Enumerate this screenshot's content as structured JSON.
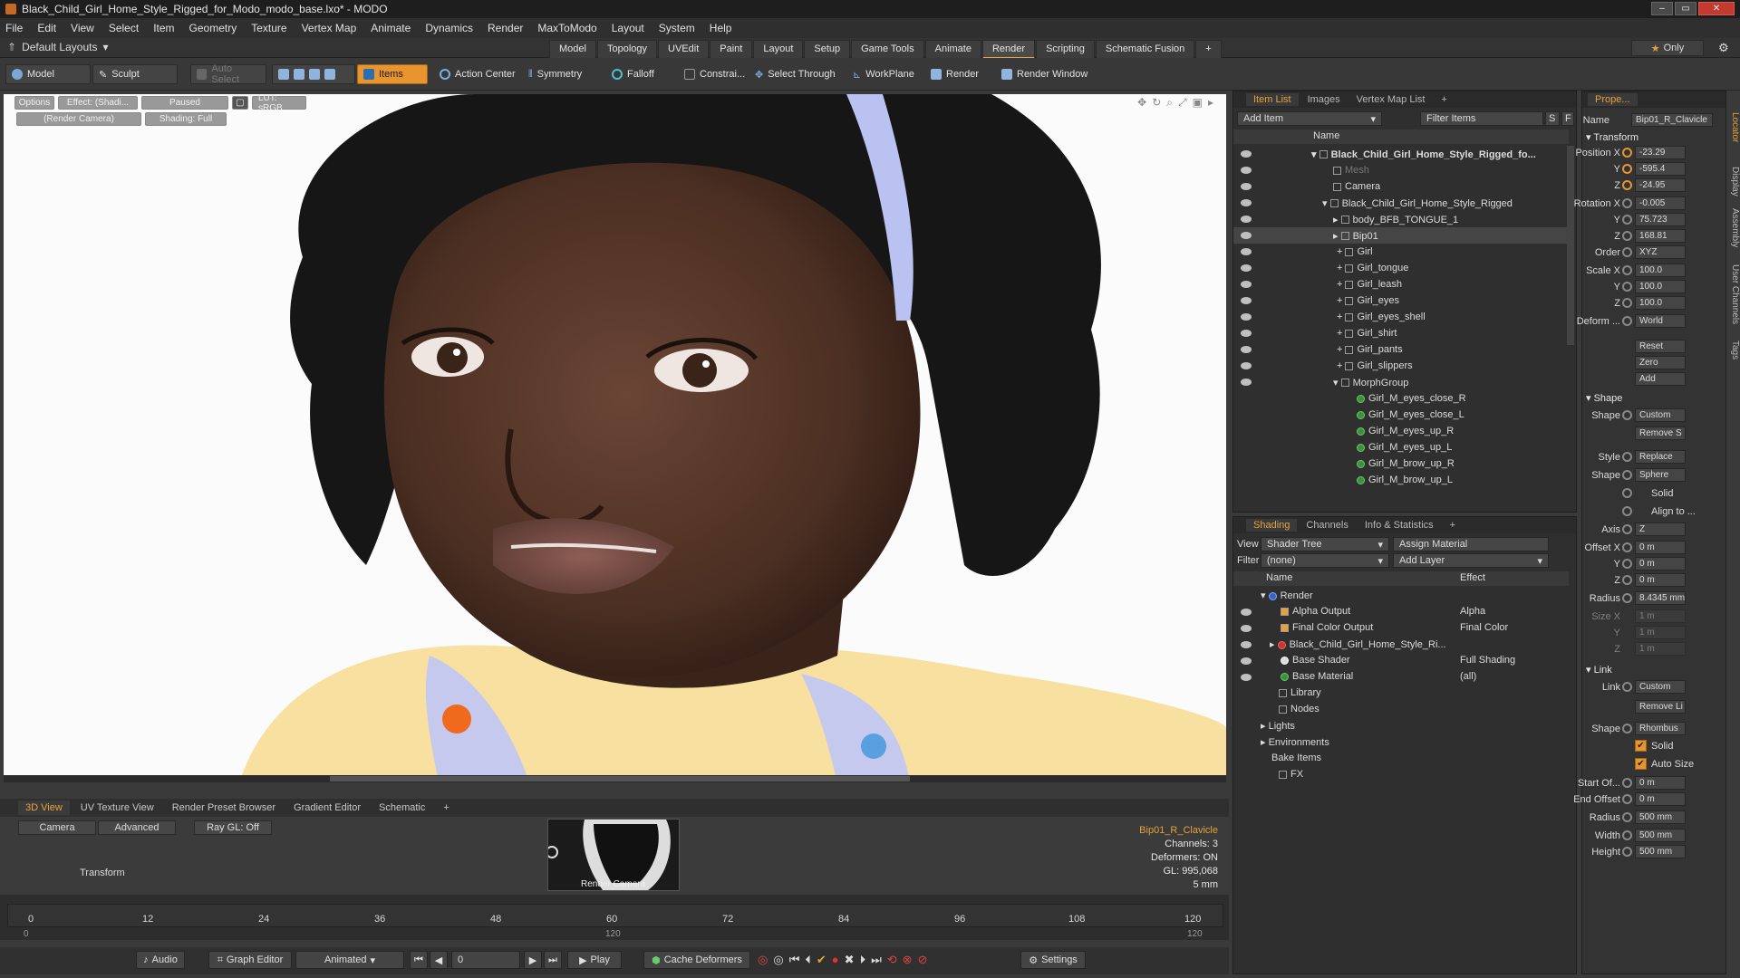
{
  "window": {
    "title": "Black_Child_Girl_Home_Style_Rigged_for_Modo_modo_base.lxo* - MODO",
    "controls": [
      "–",
      "▭",
      "✕"
    ]
  },
  "menu": [
    "File",
    "Edit",
    "View",
    "Select",
    "Item",
    "Geometry",
    "Texture",
    "Vertex Map",
    "Animate",
    "Dynamics",
    "Render",
    "MaxToModo",
    "Layout",
    "System",
    "Help"
  ],
  "layouts": {
    "dropdown": "Default Layouts",
    "tabs": [
      "Model",
      "Topology",
      "UVEdit",
      "Paint",
      "Layout",
      "Setup",
      "Game Tools",
      "Animate",
      "Render",
      "Scripting",
      "Schematic Fusion"
    ],
    "active_tab": "Render",
    "add": "+",
    "only": "Only"
  },
  "toolbar": {
    "model": "Model",
    "sculpt": "Sculpt",
    "auto_select": "Auto Select",
    "items": "Items",
    "action_center": "Action Center",
    "symmetry": "Symmetry",
    "falloff": "Falloff",
    "constrain": "Constrai...",
    "select_through": "Select Through",
    "workplane": "WorkPlane",
    "render": "Render",
    "render_window": "Render Window"
  },
  "viewport": {
    "chips": [
      "Options",
      "Effect: (Shadi...",
      "Paused",
      "LUT: sRGB",
      "(Render Camera)",
      "Shading: Full"
    ]
  },
  "bottom_tabs": [
    "3D View",
    "UV Texture View",
    "Render Preset Browser",
    "Gradient Editor",
    "Schematic",
    "+"
  ],
  "view_options": [
    "Camera",
    "Advanced",
    "Ray GL: Off"
  ],
  "transform_label": "Transform",
  "render_camera_label": "Render Camera",
  "status": {
    "selected": "Bip01_R_Clavicle",
    "channels": "Channels: 3",
    "deformers": "Deformers: ON",
    "gl": "GL: 995,068",
    "size": "5 mm"
  },
  "timeline": {
    "ticks": [
      "0",
      "12",
      "24",
      "36",
      "48",
      "60",
      "72",
      "84",
      "96",
      "108",
      "120"
    ],
    "sub_ticks": [
      "0",
      "120",
      "120"
    ]
  },
  "transport": {
    "audio": "Audio",
    "graph_editor": "Graph Editor",
    "animated": "Animated",
    "frame": "0",
    "play": "Play",
    "cache_deformers": "Cache Deformers",
    "settings": "Settings"
  },
  "item_list": {
    "tabs": [
      "Item List",
      "Images",
      "Vertex Map List",
      "+"
    ],
    "add_item": "Add Item",
    "filter_items": "Filter Items",
    "s": "S",
    "f": "F",
    "column": "Name",
    "rows": [
      "Black_Child_Girl_Home_Style_Rigged_fo...",
      "Mesh",
      "Camera",
      "Black_Child_Girl_Home_Style_Rigged",
      "body_BFB_TONGUE_1",
      "Bip01",
      "Girl",
      "Girl_tongue",
      "Girl_leash",
      "Girl_eyes",
      "Girl_eyes_shell",
      "Girl_shirt",
      "Girl_pants",
      "Girl_slippers",
      "MorphGroup",
      "Girl_M_eyes_close_R",
      "Girl_M_eyes_close_L",
      "Girl_M_eyes_up_R",
      "Girl_M_eyes_up_L",
      "Girl_M_brow_up_R",
      "Girl_M_brow_up_L"
    ]
  },
  "shading": {
    "tabs": [
      "Shading",
      "Channels",
      "Info & Statistics",
      "+"
    ],
    "view_label": "View",
    "view_value": "Shader Tree",
    "assign_material": "Assign Material",
    "filter_label": "Filter",
    "filter_value": "(none)",
    "add_layer": "Add Layer",
    "col_name": "Name",
    "col_effect": "Effect",
    "rows": [
      {
        "name": "Render",
        "effect": ""
      },
      {
        "name": "Alpha Output",
        "effect": "Alpha"
      },
      {
        "name": "Final Color Output",
        "effect": "Final Color"
      },
      {
        "name": "Black_Child_Girl_Home_Style_Ri...",
        "effect": ""
      },
      {
        "name": "Base Shader",
        "effect": "Full Shading"
      },
      {
        "name": "Base Material",
        "effect": "(all)"
      },
      {
        "name": "Library",
        "effect": ""
      },
      {
        "name": "Nodes",
        "effect": ""
      },
      {
        "name": "Lights",
        "effect": ""
      },
      {
        "name": "Environments",
        "effect": ""
      },
      {
        "name": "Bake Items",
        "effect": ""
      },
      {
        "name": "FX",
        "effect": ""
      }
    ]
  },
  "properties": {
    "tab": "Prope...",
    "name_label": "Name",
    "name_value": "Bip01_R_Clavicle",
    "transform": "Transform",
    "position_x_label": "Position X",
    "position_x": "-23.29",
    "position_y_label": "Y",
    "position_y": "-595.4",
    "position_z_label": "Z",
    "position_z": "-24.95",
    "rotation_x_label": "Rotation X",
    "rotation_x": "-0.005",
    "rotation_y_label": "Y",
    "rotation_y": "75.723",
    "rotation_z_label": "Z",
    "rotation_z": "168.81",
    "order_label": "Order",
    "order": "XYZ",
    "scale_x_label": "Scale X",
    "scale_x": "100.0",
    "scale_y_label": "Y",
    "scale_y": "100.0",
    "scale_z_label": "Z",
    "scale_z": "100.0",
    "deform_label": "Deform ...",
    "deform": "World",
    "reset": "Reset",
    "zero": "Zero",
    "add": "Add",
    "shape_section": "Shape",
    "shape_label": "Shape",
    "shape": "Custom",
    "remove_s": "Remove S ...",
    "style_label": "Style",
    "style": "Replace",
    "shape2_label": "Shape",
    "shape2": "Sphere",
    "solid": "Solid",
    "align_to": "Align to ...",
    "axis_label": "Axis",
    "axis": "Z",
    "offset_x_label": "Offset X",
    "offset_x": "0 m",
    "offset_y_label": "Y",
    "offset_y": "0 m",
    "offset_z_label": "Z",
    "offset_z": "0 m",
    "radius_label": "Radius",
    "radius": "8.4345 mm",
    "size_x_label": "Size X",
    "size_x": "1 m",
    "size_y_label": "Y",
    "size_y": "1 m",
    "size_z_label": "Z",
    "size_z": "1 m",
    "link_section": "Link",
    "link_label": "Link",
    "link": "Custom",
    "remove_li": "Remove Li ...",
    "link_shape_label": "Shape",
    "link_shape": "Rhombus",
    "solid2": "Solid",
    "auto_size": "Auto Size",
    "start_off_label": "Start Of...",
    "start_off": "0 m",
    "end_offset_label": "End Offset",
    "end_offset": "0 m",
    "radius2_label": "Radius",
    "radius2": "500 mm",
    "width_label": "Width",
    "width": "500 mm",
    "height_label": "Height",
    "height": "500 mm",
    "side_tabs": [
      "Locator",
      "Display",
      "Assembly",
      "User Channels",
      "Tags"
    ]
  }
}
